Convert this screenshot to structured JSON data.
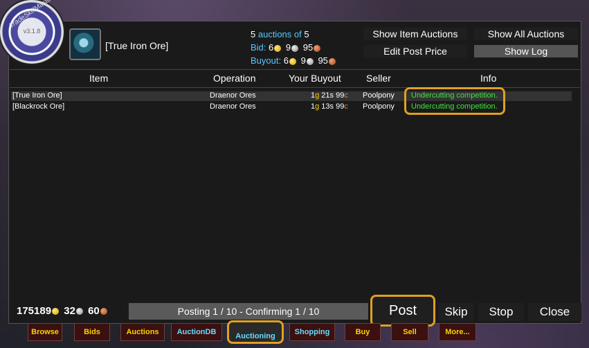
{
  "logo": {
    "version": "v3.1.8",
    "arc_text": "TradeSkillMaster"
  },
  "item": {
    "name": "[True Iron Ore]",
    "icon": "ore-icon"
  },
  "summary": {
    "count": "5",
    "auctions_of": "auctions of",
    "total": "5",
    "bid_label": "Bid:",
    "bid": {
      "gold": "6",
      "silver": "9",
      "copper": "95"
    },
    "buyout_label": "Buyout:",
    "buyout": {
      "gold": "6",
      "silver": "9",
      "copper": "95"
    }
  },
  "header_buttons": {
    "show_item_auctions": "Show Item Auctions",
    "show_all_auctions": "Show All Auctions",
    "edit_post_price": "Edit Post Price",
    "show_log": "Show Log"
  },
  "table": {
    "columns": [
      "Item",
      "Operation",
      "Your Buyout",
      "Seller",
      "Info"
    ],
    "rows": [
      {
        "item": "[True Iron Ore]",
        "operation": "Draenor Ores",
        "buyout_g": "1",
        "buyout_s": " 21s ",
        "buyout_c": "99",
        "seller": "Poolpony",
        "info": "Undercutting competition."
      },
      {
        "item": "[Blackrock Ore]",
        "operation": "Draenor Ores",
        "buyout_g": "1",
        "buyout_s": " 13s ",
        "buyout_c": "99",
        "seller": "Poolpony",
        "info": "Undercutting competition."
      }
    ]
  },
  "money": {
    "gold": "175189",
    "silver": "32",
    "copper": "60"
  },
  "status": "Posting 1 / 10  -  Confirming 1 / 10",
  "footer_buttons": {
    "post": "Post",
    "skip": "Skip",
    "stop": "Stop",
    "close": "Close"
  },
  "tabs": [
    "Browse",
    "Bids",
    "Auctions",
    "AuctionDB",
    "Auctioning",
    "Shopping",
    "Buy",
    "Sell",
    "More..."
  ],
  "colors": {
    "highlight": "#e0a020",
    "gold_text": "#ffd100",
    "cyan_text": "#58c8ff",
    "info_green": "#3ee63e"
  }
}
